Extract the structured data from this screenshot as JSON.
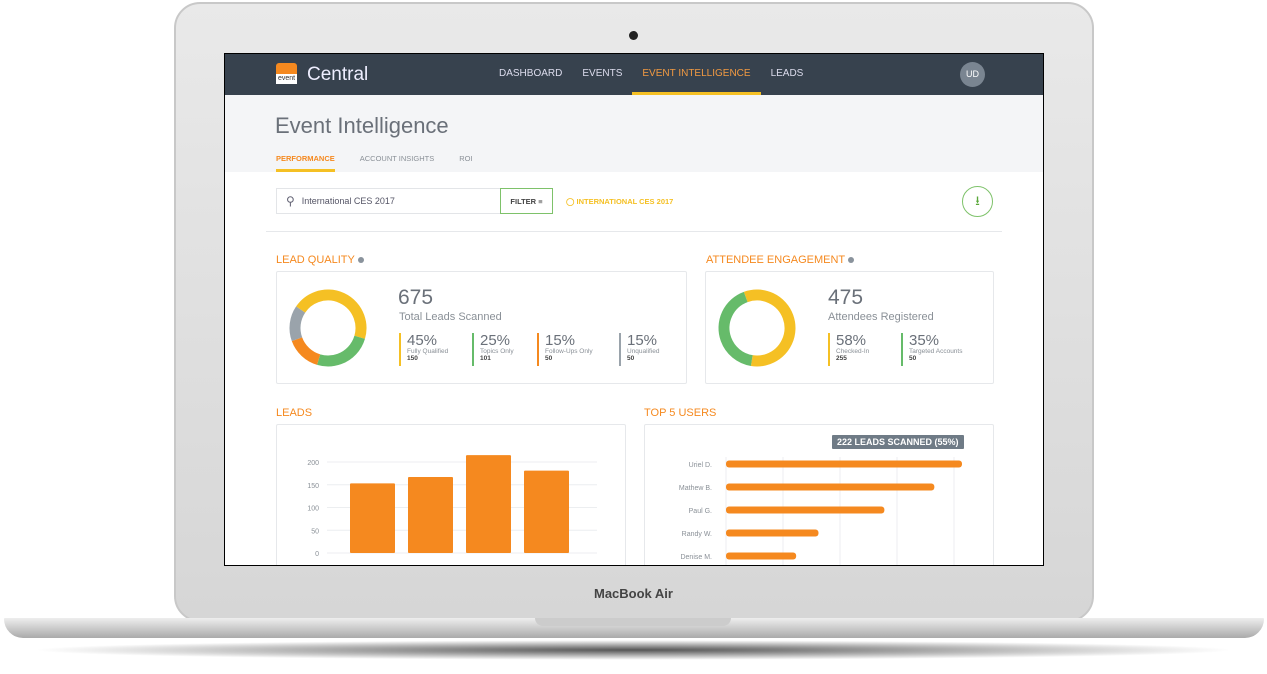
{
  "device": {
    "brand": "MacBook Air"
  },
  "nav": {
    "logo_text": "event",
    "app_title": "Central",
    "items": [
      "DASHBOARD",
      "EVENTS",
      "EVENT INTELLIGENCE",
      "LEADS"
    ],
    "active": "EVENT INTELLIGENCE",
    "avatar": "UD"
  },
  "page": {
    "title": "Event Intelligence",
    "tabs": [
      "PERFORMANCE",
      "ACCOUNT INSIGHTS",
      "ROI"
    ],
    "active_tab": "PERFORMANCE"
  },
  "toolbar": {
    "search_value": "International CES 2017",
    "filter_label": "FILTER",
    "active_filter": "INTERNATIONAL CES 2017"
  },
  "colors": {
    "orange": "#f5891f",
    "yellow": "#f5c024",
    "green": "#66bb6a",
    "gray": "#9aa3ab",
    "nav": "#37424e"
  },
  "lead_quality": {
    "title": "LEAD QUALITY",
    "total": "675",
    "total_label": "Total Leads Scanned",
    "stats": [
      {
        "pct": "45%",
        "label": "Fully Qualified",
        "count": "150",
        "color": "#f5c024",
        "value": 45
      },
      {
        "pct": "25%",
        "label": "Topics Only",
        "count": "101",
        "color": "#66bb6a",
        "value": 25
      },
      {
        "pct": "15%",
        "label": "Follow-Ups Only",
        "count": "50",
        "color": "#f5891f",
        "value": 15
      },
      {
        "pct": "15%",
        "label": "Unqualified",
        "count": "50",
        "color": "#9aa3ab",
        "value": 15
      }
    ]
  },
  "engagement": {
    "title": "ATTENDEE ENGAGEMENT",
    "total": "475",
    "total_label": "Attendees Registered",
    "stats": [
      {
        "pct": "58%",
        "label": "Checked-In",
        "count": "255",
        "color": "#f5c024",
        "value": 58
      },
      {
        "pct": "35%",
        "label": "Targeted Accounts",
        "count": "50",
        "color": "#66bb6a",
        "value": 42
      }
    ]
  },
  "chart_data": [
    {
      "type": "bar",
      "title": "LEADS",
      "yticks": [
        "200",
        "150",
        "100",
        "50",
        "0"
      ],
      "ylim": [
        0,
        200
      ],
      "values": [
        153,
        167,
        215,
        181
      ],
      "grid": true
    },
    {
      "type": "bar",
      "orientation": "horizontal",
      "title": "TOP 5 USERS",
      "categories": [
        "Uriel D.",
        "Mathew B.",
        "Paul G.",
        "Randy W.",
        "Denise M."
      ],
      "values": [
        222,
        196,
        149,
        87,
        66
      ],
      "tooltip": "222 LEADS SCANNED (55%)",
      "grid": true
    }
  ]
}
